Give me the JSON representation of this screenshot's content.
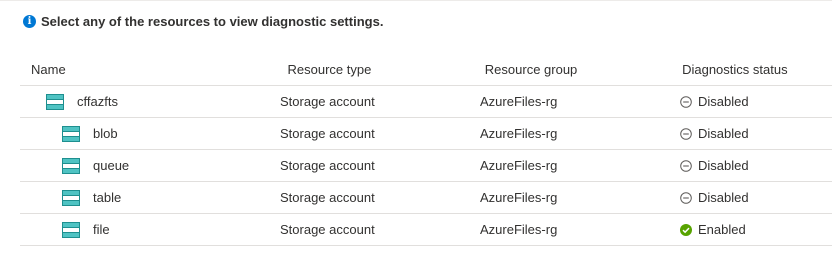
{
  "info": {
    "icon": "info-icon",
    "text": "Select any of the resources to view diagnostic settings."
  },
  "table": {
    "headers": {
      "name": "Name",
      "type": "Resource type",
      "group": "Resource group",
      "status": "Diagnostics status"
    },
    "rows": [
      {
        "name": "cffazfts",
        "type": "Storage account",
        "group": "AzureFiles-rg",
        "status": "Disabled",
        "icon": "storage-account-icon",
        "status_icon": "disabled-icon"
      },
      {
        "name": "blob",
        "type": "Storage account",
        "group": "AzureFiles-rg",
        "status": "Disabled",
        "icon": "storage-account-icon",
        "status_icon": "disabled-icon"
      },
      {
        "name": "queue",
        "type": "Storage account",
        "group": "AzureFiles-rg",
        "status": "Disabled",
        "icon": "storage-account-icon",
        "status_icon": "disabled-icon"
      },
      {
        "name": "table",
        "type": "Storage account",
        "group": "AzureFiles-rg",
        "status": "Disabled",
        "icon": "storage-account-icon",
        "status_icon": "disabled-icon"
      },
      {
        "name": "file",
        "type": "Storage account",
        "group": "AzureFiles-rg",
        "status": "Enabled",
        "icon": "storage-account-icon",
        "status_icon": "enabled-check-icon"
      }
    ]
  },
  "colors": {
    "info_blue": "#0078d4",
    "storage_teal": "#32a4a4",
    "enabled_green": "#57a300",
    "disabled_gray": "#605e5c"
  }
}
